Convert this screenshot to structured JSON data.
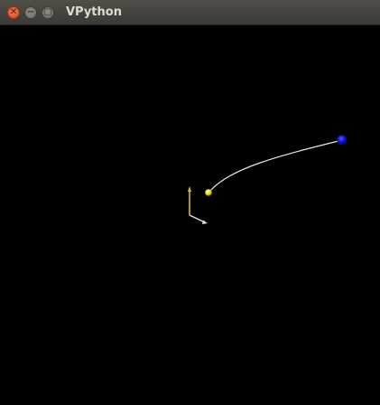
{
  "window": {
    "title": "VPython",
    "buttons": {
      "close_glyph": "✕",
      "minimize_glyph": "−",
      "maximize_glyph": "▢"
    }
  },
  "scene": {
    "background_color": "#000000",
    "objects": [
      {
        "name": "blue-sphere",
        "kind": "sphere",
        "color": "#1010d8"
      },
      {
        "name": "yellow-sphere",
        "kind": "sphere",
        "color": "#f0e020"
      },
      {
        "name": "trail",
        "kind": "curve",
        "color": "#e6e6e6"
      },
      {
        "name": "y-arrow",
        "kind": "arrow",
        "color": "#d8c000"
      },
      {
        "name": "x-arrow",
        "kind": "arrow",
        "color": "#e0e0e0"
      }
    ]
  }
}
